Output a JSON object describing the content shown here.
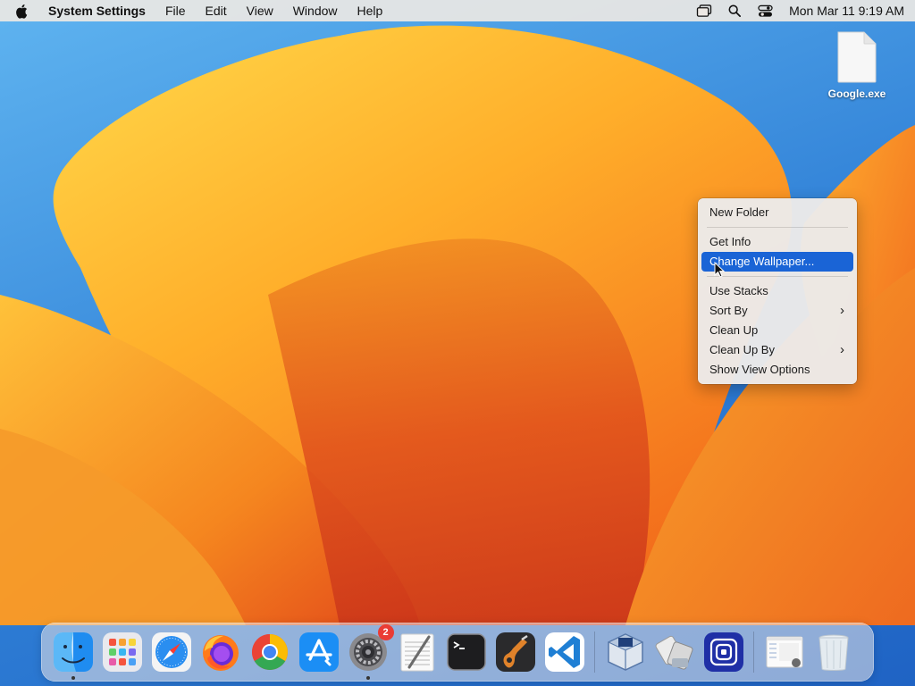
{
  "menubar": {
    "app_name": "System Settings",
    "menus": [
      "File",
      "Edit",
      "View",
      "Window",
      "Help"
    ],
    "clock": "Mon Mar 11  9:19 AM"
  },
  "desktop": {
    "file_label": "Google.exe"
  },
  "context_menu": {
    "items": [
      {
        "label": "New Folder"
      },
      {
        "label": "Get Info"
      },
      {
        "label": "Change Wallpaper..."
      },
      {
        "label": "Use Stacks"
      },
      {
        "label": "Sort By"
      },
      {
        "label": "Clean Up"
      },
      {
        "label": "Clean Up By"
      },
      {
        "label": "Show View Options"
      }
    ],
    "highlighted": "Change Wallpaper..."
  },
  "dock": {
    "apps": [
      "finder-icon",
      "launchpad-icon",
      "safari-icon",
      "firefox-icon",
      "chrome-icon",
      "app-store-icon",
      "system-settings-icon",
      "textedit-icon",
      "terminal-icon",
      "garageband-icon",
      "vscode-icon",
      "virtualbox-icon",
      "migration-assistant-icon",
      "app-icon",
      "downloads-stack-icon",
      "trash-icon"
    ],
    "system_settings_badge": "2",
    "running": [
      "finder-icon",
      "system-settings-icon"
    ]
  },
  "colors": {
    "highlight": "#1a64d6",
    "badge": "#ea3c35",
    "wallpaper_orange": "#f7941d",
    "wallpaper_blue": "#2f7fd6"
  }
}
